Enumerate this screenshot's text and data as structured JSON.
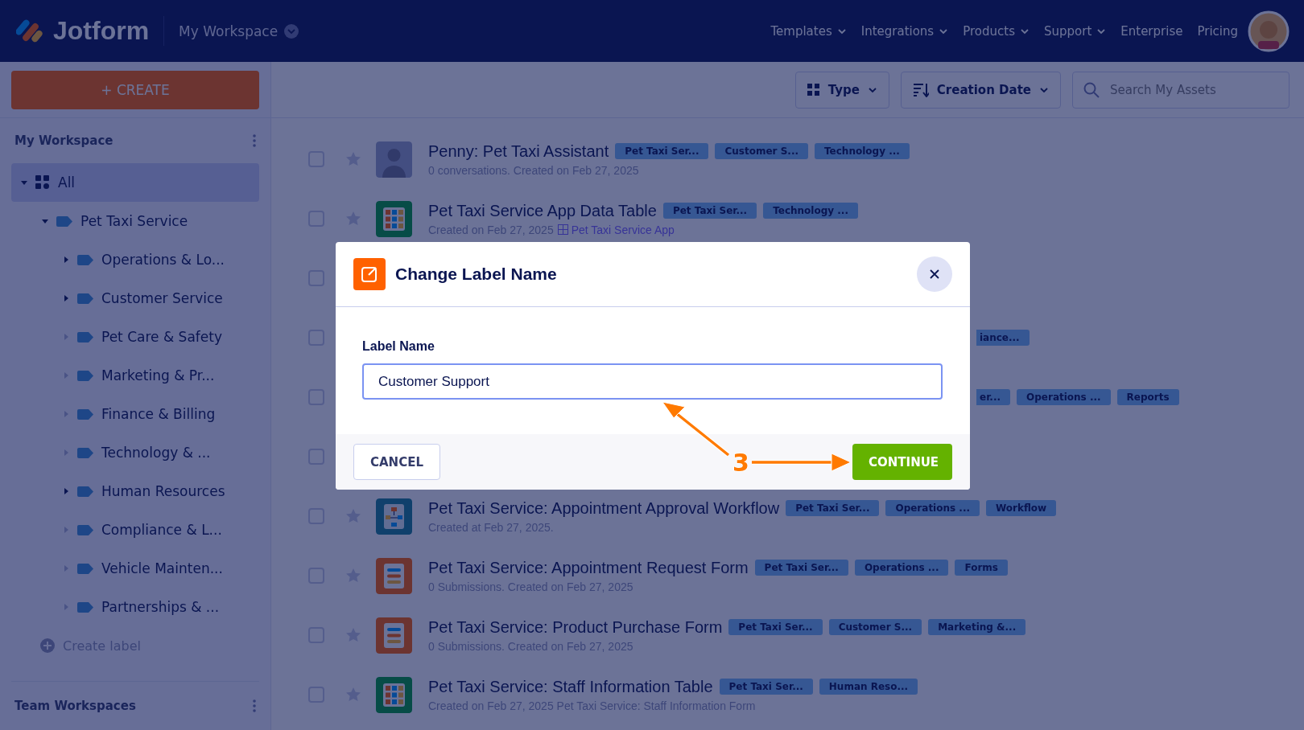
{
  "header": {
    "logo": "Jotform",
    "workspace": "My Workspace",
    "nav": [
      {
        "label": "Templates",
        "has_menu": true
      },
      {
        "label": "Integrations",
        "has_menu": true
      },
      {
        "label": "Products",
        "has_menu": true
      },
      {
        "label": "Support",
        "has_menu": true
      },
      {
        "label": "Enterprise",
        "has_menu": false
      },
      {
        "label": "Pricing",
        "has_menu": false
      }
    ]
  },
  "sidebar": {
    "create_button": "+ CREATE",
    "section_title": "My Workspace",
    "tree": [
      {
        "label": "All",
        "kind": "all",
        "selected": true,
        "expanded": true,
        "children": [
          {
            "label": "Pet Taxi Service",
            "kind": "label",
            "selected": false,
            "expanded": true,
            "children": [
              {
                "label": "Operations & Lo...",
                "kind": "label",
                "selected": false,
                "expanded": false,
                "has_sublabels": true
              },
              {
                "label": "Customer Service",
                "kind": "label",
                "selected": false,
                "expanded": false,
                "has_sublabels": true
              },
              {
                "label": "Pet Care & Safety",
                "kind": "label",
                "selected": false,
                "expanded": false,
                "has_sublabels": false
              },
              {
                "label": "Marketing & Pr...",
                "kind": "label",
                "selected": false,
                "expanded": false,
                "has_sublabels": false
              },
              {
                "label": "Finance & Billing",
                "kind": "label",
                "selected": false,
                "expanded": false,
                "has_sublabels": false
              },
              {
                "label": "Technology & ...",
                "kind": "label",
                "selected": false,
                "expanded": false,
                "has_sublabels": false
              },
              {
                "label": "Human Resources",
                "kind": "label",
                "selected": false,
                "expanded": false,
                "has_sublabels": true
              },
              {
                "label": "Compliance & L...",
                "kind": "label",
                "selected": false,
                "expanded": false,
                "has_sublabels": false
              },
              {
                "label": "Vehicle Mainten...",
                "kind": "label",
                "selected": false,
                "expanded": false,
                "has_sublabels": false
              },
              {
                "label": "Partnerships & ...",
                "kind": "label",
                "selected": false,
                "expanded": false,
                "has_sublabels": false
              }
            ]
          }
        ]
      }
    ],
    "create_label": "Create label",
    "team_title": "Team Workspaces"
  },
  "toolbar": {
    "type_filter": "Type",
    "sort": "Creation Date",
    "search": {
      "placeholder": "Search My Assets"
    }
  },
  "assets": [
    {
      "kind": "agent",
      "checked": false,
      "title": "Penny: Pet Taxi Assistant",
      "subtitle": "0 conversations. Created on Feb 27, 2025",
      "tags": [
        "Pet Taxi Ser...",
        "Customer S...",
        "Technology ..."
      ]
    },
    {
      "kind": "table",
      "checked": false,
      "title": "Pet Taxi Service App Data Table",
      "subtitle": "Created on Feb 27, 2025",
      "link": "Pet Taxi Service App",
      "tags": [
        "Pet Taxi Ser...",
        "Technology ..."
      ]
    },
    {
      "kind": "covered",
      "checked": false
    },
    {
      "kind": "covered",
      "checked": false,
      "tags": [
        "iance..."
      ]
    },
    {
      "kind": "covered",
      "checked": false,
      "tags": [
        "er...",
        "Operations ...",
        "Reports"
      ]
    },
    {
      "kind": "covered",
      "checked": false
    },
    {
      "kind": "workflow",
      "checked": false,
      "title": "Pet Taxi Service: Appointment Approval Workflow",
      "subtitle": "Created at Feb 27, 2025.",
      "tags": [
        "Pet Taxi Ser...",
        "Operations ...",
        "Workflow"
      ]
    },
    {
      "kind": "form",
      "checked": false,
      "title": "Pet Taxi Service: Appointment Request Form",
      "subtitle": "0 Submissions. Created on Feb 27, 2025",
      "tags": [
        "Pet Taxi Ser...",
        "Operations ...",
        "Forms"
      ]
    },
    {
      "kind": "form",
      "checked": false,
      "title": "Pet Taxi Service: Product Purchase Form",
      "subtitle": "0 Submissions. Created on Feb 27, 2025",
      "tags": [
        "Pet Taxi Ser...",
        "Customer S...",
        "Marketing &..."
      ]
    },
    {
      "kind": "table",
      "checked": false,
      "title": "Pet Taxi Service: Staff Information Table",
      "subtitle": "Created on Feb 27, 2025 Pet Taxi Service: Staff Information Form",
      "tags": [
        "Pet Taxi Ser...",
        "Human Reso..."
      ]
    }
  ],
  "modal": {
    "title": "Change Label Name",
    "field_label": "Label Name",
    "value": "Customer Support",
    "buttons": [
      {
        "label": "CANCEL",
        "kind": "secondary"
      },
      {
        "label": "CONTINUE",
        "kind": "primary"
      }
    ]
  },
  "annotation": {
    "number": "3"
  }
}
